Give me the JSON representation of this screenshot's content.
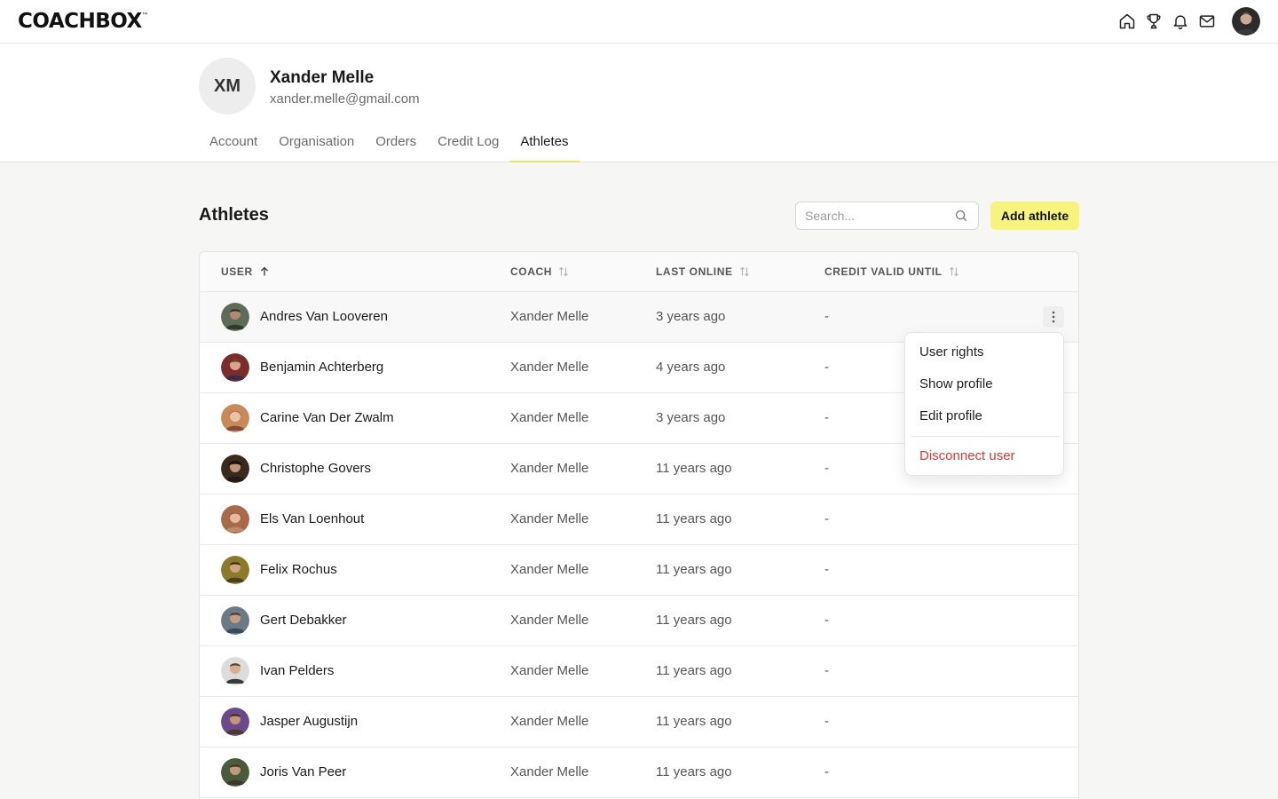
{
  "app": {
    "logo": "COACHBOX",
    "logo_tm": "™"
  },
  "topnav": {
    "icons": [
      "home-icon",
      "trophy-icon",
      "bell-icon",
      "mail-icon"
    ]
  },
  "profile": {
    "initials": "XM",
    "name": "Xander Melle",
    "email": "xander.melle@gmail.com"
  },
  "tabs": [
    {
      "label": "Account",
      "active": false
    },
    {
      "label": "Organisation",
      "active": false
    },
    {
      "label": "Orders",
      "active": false
    },
    {
      "label": "Credit Log",
      "active": false
    },
    {
      "label": "Athletes",
      "active": true
    }
  ],
  "section": {
    "title": "Athletes",
    "search_placeholder": "Search...",
    "add_label": "Add athlete"
  },
  "table": {
    "headers": {
      "user": "USER",
      "coach": "COACH",
      "last_online": "LAST ONLINE",
      "credit": "CREDIT VALID UNTIL"
    },
    "rows": [
      {
        "name": "Andres Van Looveren",
        "coach": "Xander Melle",
        "last_online": "3 years ago",
        "credit": "-"
      },
      {
        "name": "Benjamin Achterberg",
        "coach": "Xander Melle",
        "last_online": "4 years ago",
        "credit": "-"
      },
      {
        "name": "Carine Van Der Zwalm",
        "coach": "Xander Melle",
        "last_online": "3 years ago",
        "credit": "-"
      },
      {
        "name": "Christophe Govers",
        "coach": "Xander Melle",
        "last_online": "11 years ago",
        "credit": "-"
      },
      {
        "name": "Els Van Loenhout",
        "coach": "Xander Melle",
        "last_online": "11 years ago",
        "credit": "-"
      },
      {
        "name": "Felix Rochus",
        "coach": "Xander Melle",
        "last_online": "11 years ago",
        "credit": "-"
      },
      {
        "name": "Gert Debakker",
        "coach": "Xander Melle",
        "last_online": "11 years ago",
        "credit": "-"
      },
      {
        "name": "Ivan Pelders",
        "coach": "Xander Melle",
        "last_online": "11 years ago",
        "credit": "-"
      },
      {
        "name": "Jasper Augustijn",
        "coach": "Xander Melle",
        "last_online": "11 years ago",
        "credit": "-"
      },
      {
        "name": "Joris Van Peer",
        "coach": "Xander Melle",
        "last_online": "11 years ago",
        "credit": "-"
      }
    ]
  },
  "menu": {
    "items": [
      {
        "label": "User rights"
      },
      {
        "label": "Show profile"
      },
      {
        "label": "Edit profile"
      }
    ],
    "danger_label": "Disconnect user"
  },
  "colors": {
    "accent": "#f6f47c",
    "tab_underline": "#e8e66a",
    "danger": "#d93a3a"
  }
}
